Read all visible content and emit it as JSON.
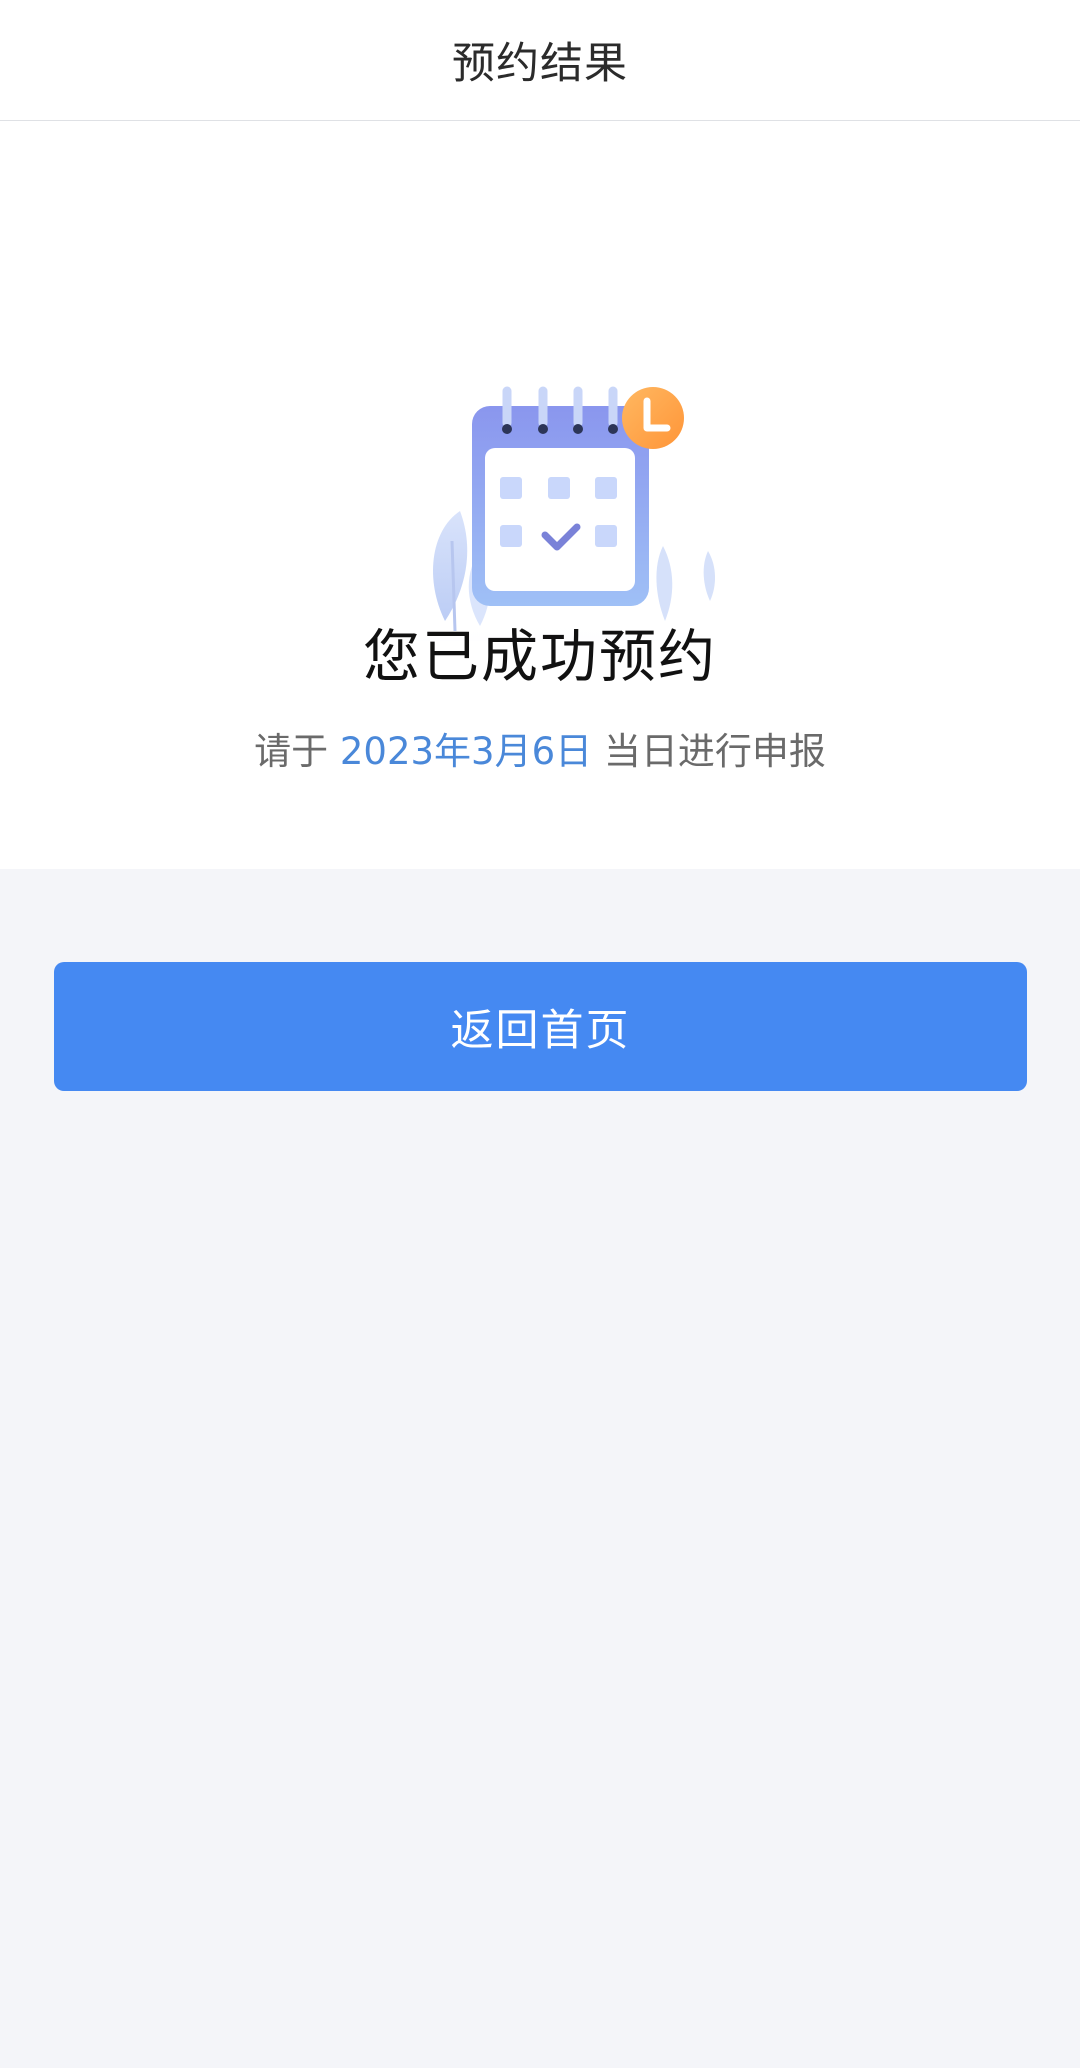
{
  "header": {
    "title": "预约结果"
  },
  "result": {
    "title": "您已成功预约",
    "subtitle_prefix": "请于",
    "date": "2023年3月6日",
    "subtitle_suffix": "当日进行申报",
    "illustration_icon": "calendar-check-icon",
    "badge_icon": "clock-icon"
  },
  "actions": {
    "home_label": "返回首页"
  },
  "colors": {
    "primary": "#4589f2",
    "date_text": "#4a88d9",
    "page_bg": "#f4f5f9",
    "badge": "#ffa447"
  }
}
